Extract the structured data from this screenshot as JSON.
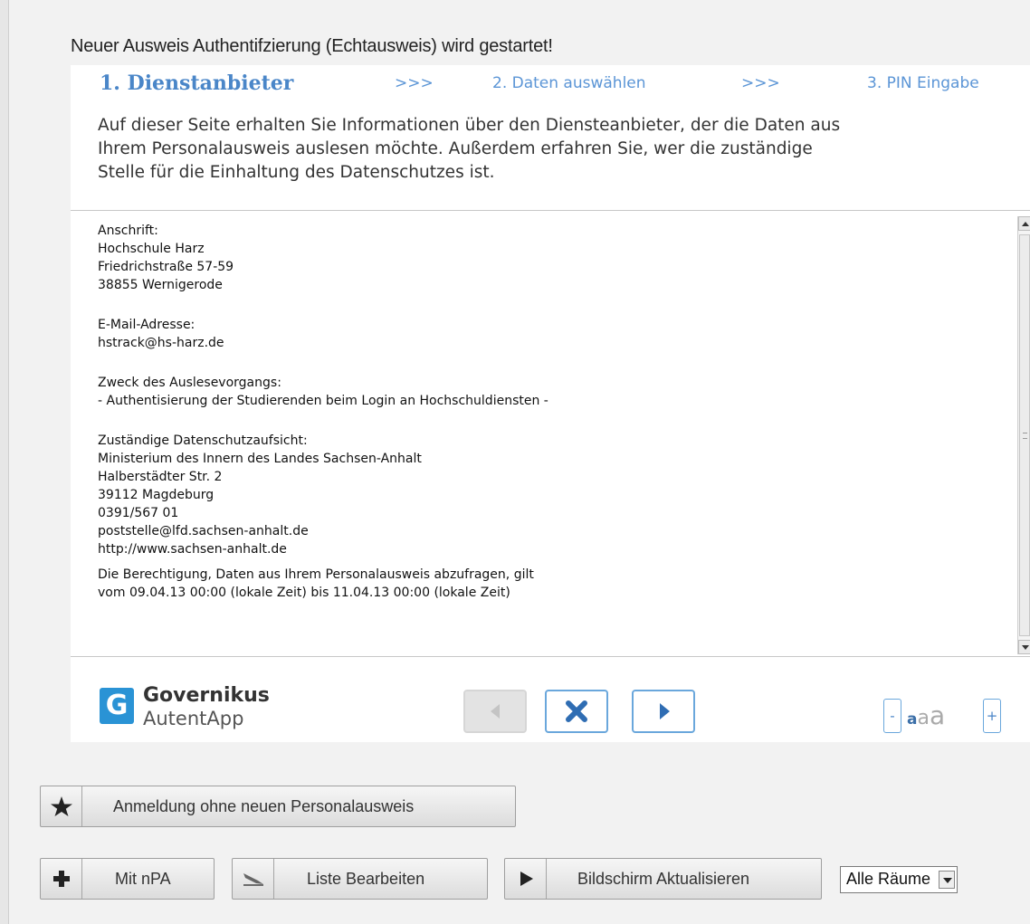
{
  "heading": "Neuer Ausweis Authentifzierung (Echtausweis) wird gestartet!",
  "steps": {
    "step1": "1. Dienstanbieter",
    "sep1": ">>>",
    "step2": "2. Daten auswählen",
    "sep2": ">>>",
    "step3": "3. PIN Eingabe"
  },
  "intro": {
    "line1": "Auf dieser Seite erhalten Sie Informationen über den Diensteanbieter, der die Daten aus",
    "line2": "Ihrem Personalausweis auslesen möchte. Außerdem erfahren Sie, wer die zuständige",
    "line3": "Stelle für die Einhaltung des Datenschutzes ist."
  },
  "info": {
    "address_label": "Anschrift:",
    "address_name": "Hochschule Harz",
    "address_street": "Friedrichstraße 57-59",
    "address_city": "38855 Wernigerode",
    "email_label": "E-Mail-Adresse:",
    "email_value": "hstrack@hs-harz.de",
    "purpose_label": "Zweck des Auslesevorgangs:",
    "purpose_value": "- Authentisierung der Studierenden beim Login an Hochschuldiensten -",
    "supervision_label": "Zuständige Datenschutzaufsicht:",
    "supervision_org": "Ministerium des Innern des Landes Sachsen-Anhalt",
    "supervision_street": "Halberstädter Str. 2",
    "supervision_city": "39112 Magdeburg",
    "supervision_phone": "0391/567 01",
    "supervision_email": "poststelle@lfd.sachsen-anhalt.de",
    "supervision_web": "http://www.sachsen-anhalt.de",
    "validity_line1": "Die Berechtigung, Daten aus Ihrem Personalausweis abzufragen, gilt",
    "validity_line2": "vom 09.04.13 00:00 (lokale Zeit) bis 11.04.13 00:00 (lokale Zeit)"
  },
  "logo": {
    "mark": "G",
    "name": "Governikus",
    "sub": "AutentApp"
  },
  "font_control": {
    "minus": "-",
    "size_small": "a",
    "size_medium": "a",
    "size_large": "a",
    "plus": "+"
  },
  "buttons": {
    "anmeldung": "Anmeldung ohne neuen Personalausweis",
    "mit_npa": "Mit nPA",
    "liste": "Liste Bearbeiten",
    "bildschirm": "Bildschirm Aktualisieren"
  },
  "room_select": {
    "value": "Alle Räume"
  },
  "icons": {
    "star": "star-icon",
    "plus": "plus-icon",
    "edit": "edit-icon",
    "play": "play-icon"
  }
}
